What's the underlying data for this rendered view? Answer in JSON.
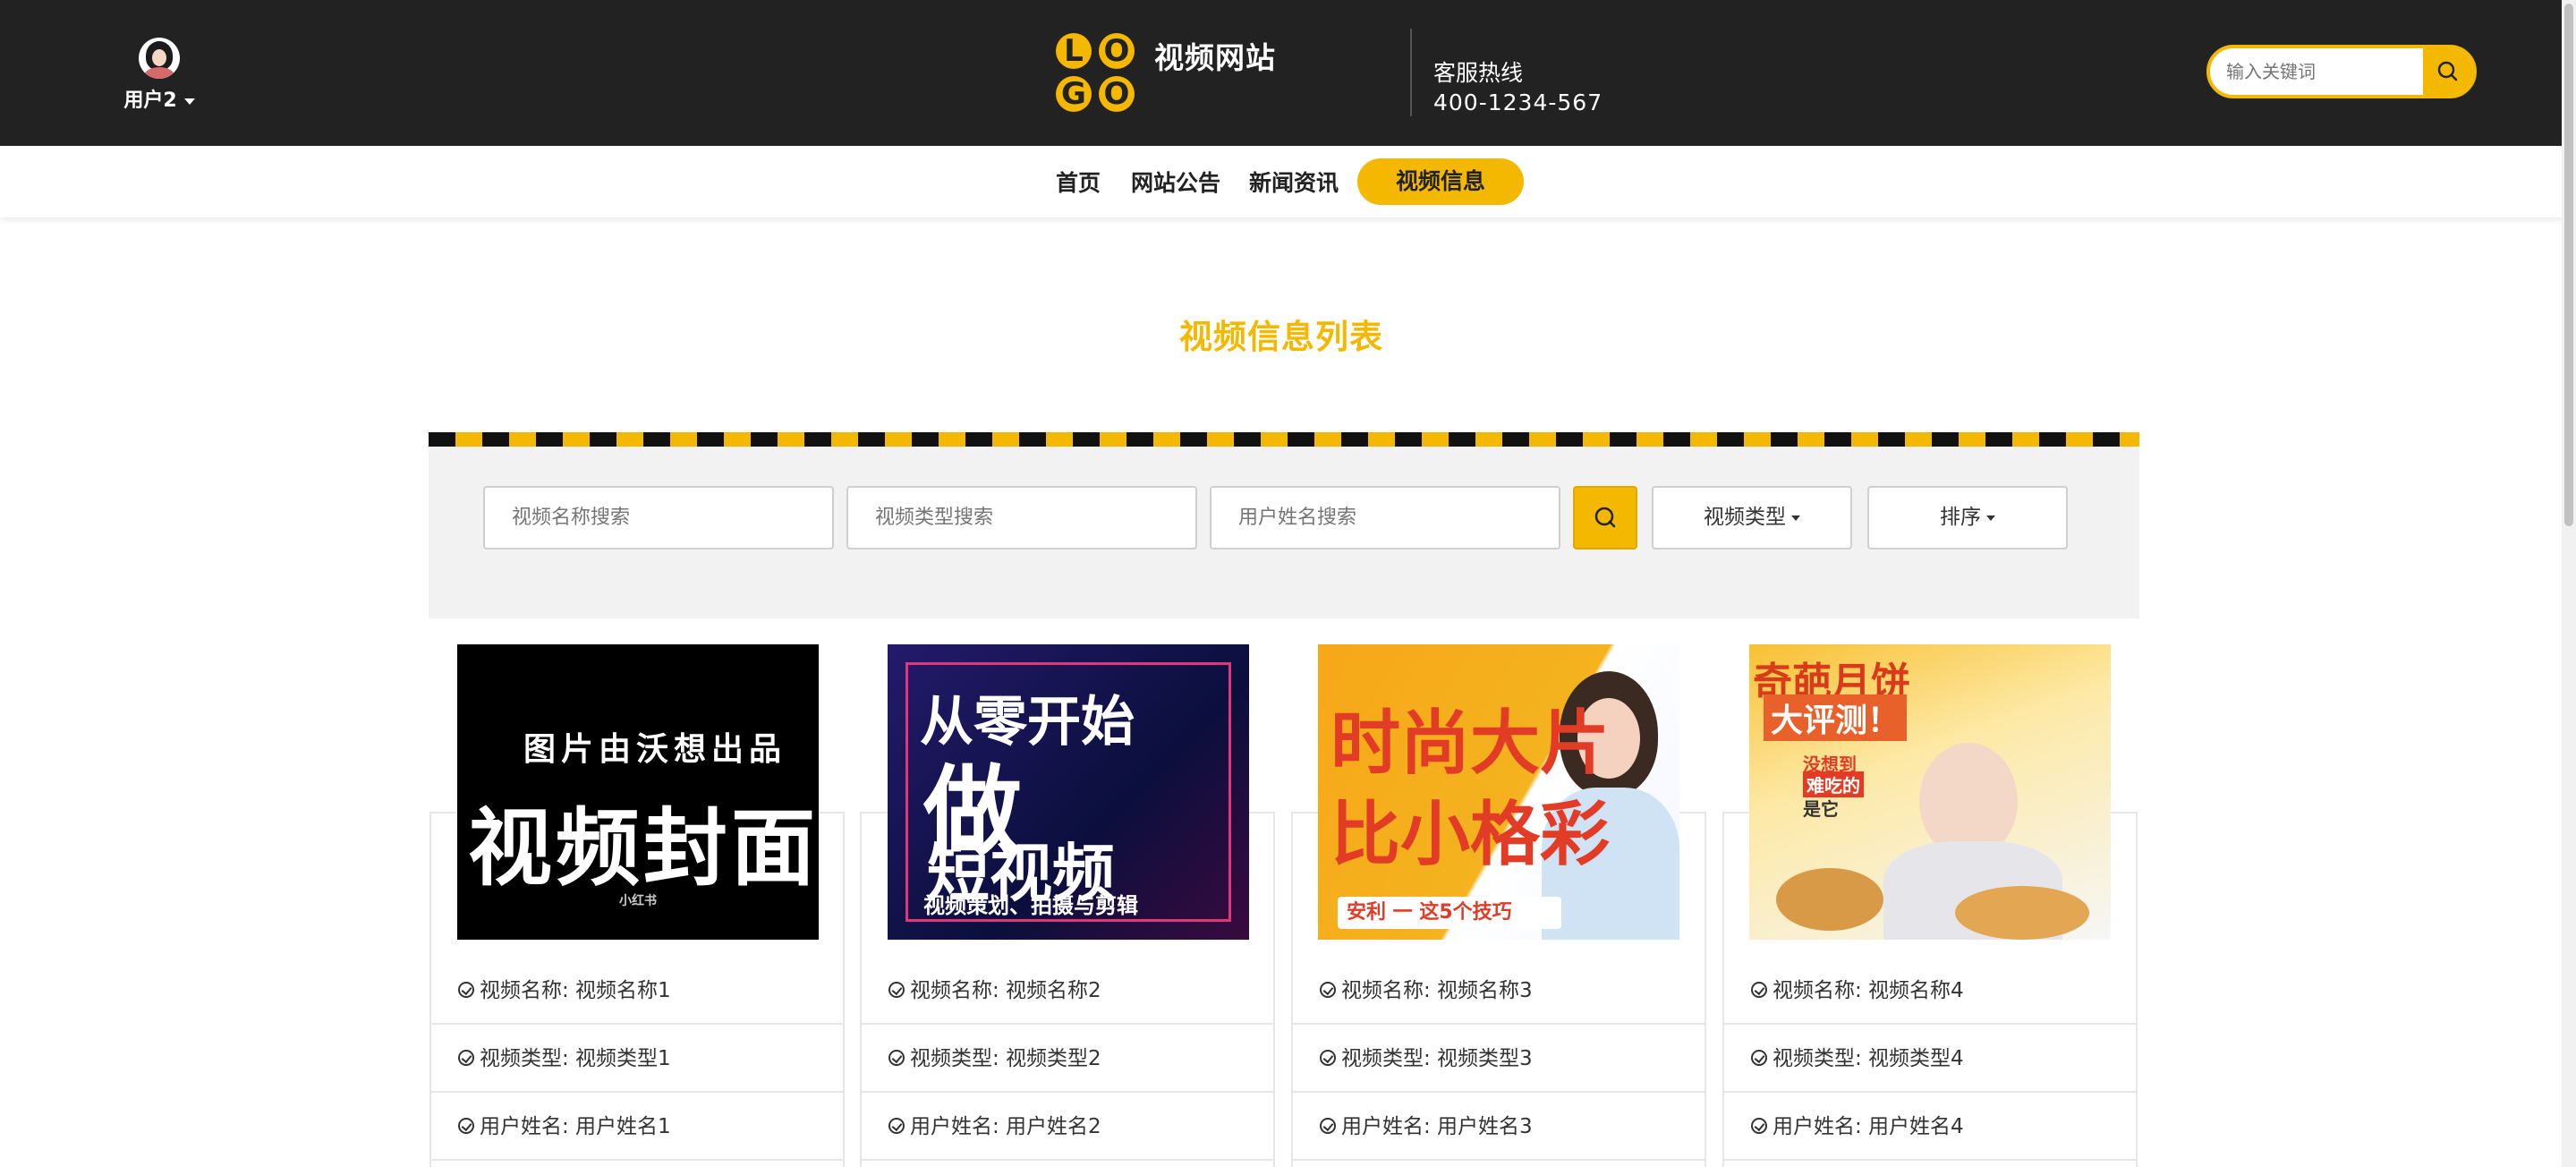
{
  "header": {
    "user_name": "用户2",
    "logo_letters": [
      "L",
      "O",
      "G",
      "O"
    ],
    "site_name": "视频网站",
    "hotline_label": "客服热线",
    "hotline_number": "400-1234-567",
    "search_placeholder": "输入关键词"
  },
  "nav": {
    "items": [
      "首页",
      "网站公告",
      "新闻资讯"
    ],
    "active": "视频信息"
  },
  "page": {
    "title": "视频信息列表"
  },
  "filters": {
    "name_placeholder": "视频名称搜索",
    "type_placeholder": "视频类型搜索",
    "user_placeholder": "用户姓名搜索",
    "type_dropdown": "视频类型",
    "sort_dropdown": "排序"
  },
  "cards": [
    {
      "thumb_lines": [
        "图片由沃想出品",
        "视频封面",
        "小红书"
      ],
      "name": "视频名称: 视频名称1",
      "type": "视频类型: 视频类型1",
      "user": "用户姓名: 用户姓名1"
    },
    {
      "thumb_lines": [
        "从零开始",
        "做",
        "短视频",
        "视频策划、拍摄与剪辑"
      ],
      "name": "视频名称: 视频名称2",
      "type": "视频类型: 视频类型2",
      "user": "用户姓名: 用户姓名2"
    },
    {
      "thumb_lines": [
        "时尚大片",
        "比小格彩",
        "安利 一 这5个技巧"
      ],
      "name": "视频名称: 视频名称3",
      "type": "视频类型: 视频类型3",
      "user": "用户姓名: 用户姓名3"
    },
    {
      "thumb_lines": [
        "奇葩月饼",
        "大评测！",
        "没想到",
        "难吃的",
        "是它"
      ],
      "name": "视频名称: 视频名称4",
      "type": "视频类型: 视频类型4",
      "user": "用户姓名: 用户姓名4"
    }
  ],
  "colors": {
    "accent": "#f5b800",
    "header_bg": "#222222",
    "panel_bg": "#f2f2f2"
  }
}
